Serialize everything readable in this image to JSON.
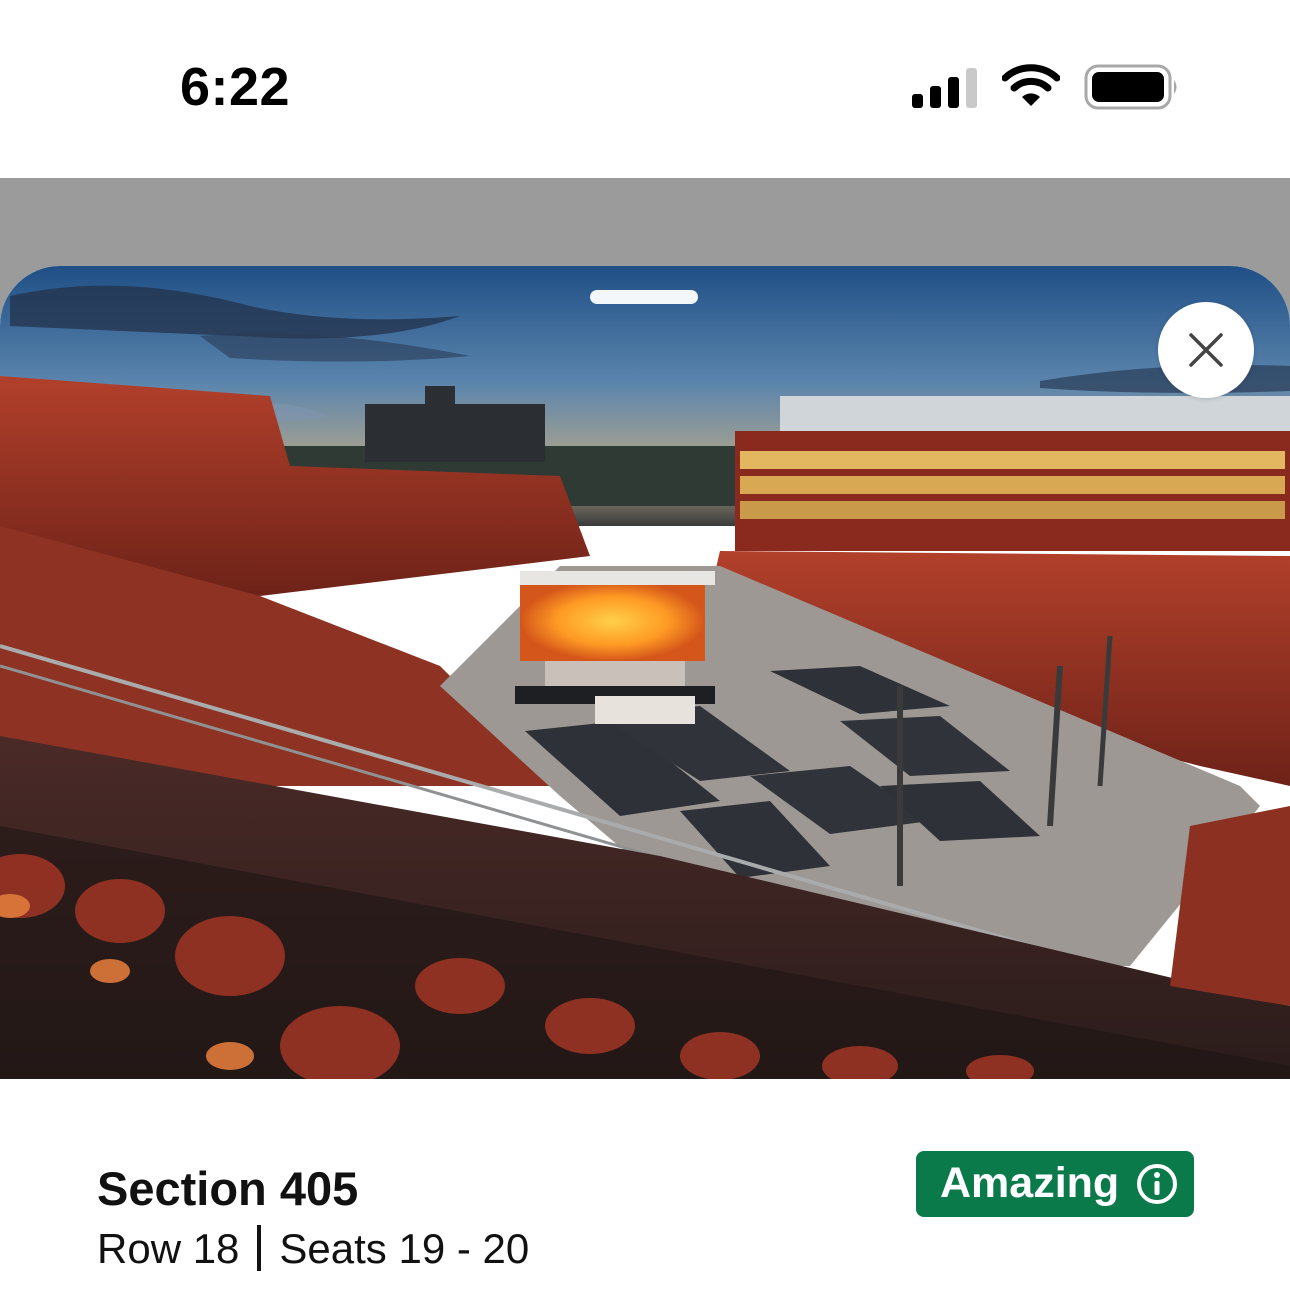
{
  "status_bar": {
    "time": "6:22",
    "icons": [
      "cellular-signal-icon",
      "wifi-icon",
      "battery-icon"
    ]
  },
  "seat_view": {
    "image": "stadium-view-from-section",
    "close_icon": "close-icon"
  },
  "seat": {
    "section": "Section 405",
    "row": "Row 18",
    "seats": "Seats 19 - 20",
    "rating": {
      "label": "Amazing",
      "icon": "info-icon",
      "color": "#0b7a4b"
    }
  }
}
